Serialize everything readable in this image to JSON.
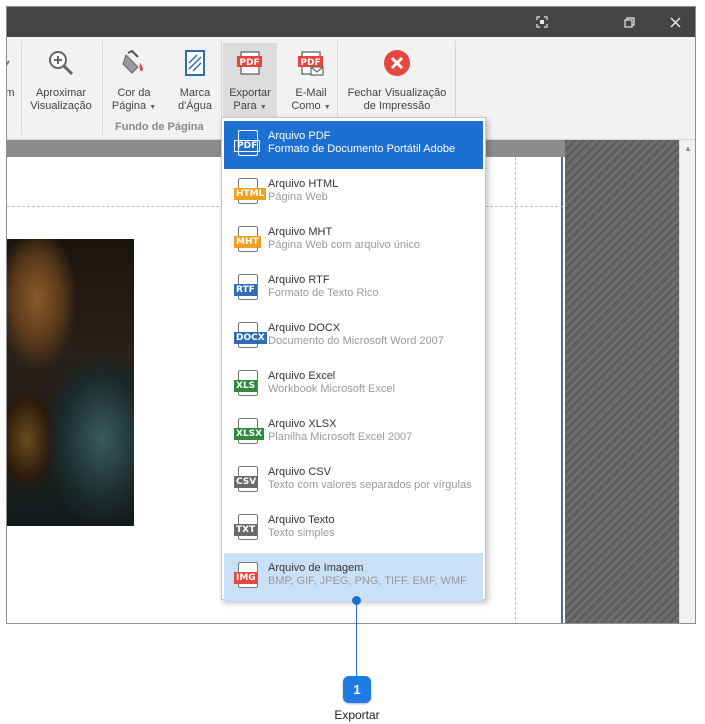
{
  "titlebar": {
    "buttons": [
      "fullscreen",
      "restore",
      "close"
    ]
  },
  "ribbon": {
    "partial_label": "m",
    "zoom": {
      "line1": "Aproximar",
      "line2": "Visualização"
    },
    "page_color": {
      "line1": "Cor da",
      "line2": "Página"
    },
    "watermark": {
      "line1": "Marca",
      "line2": "d'Água"
    },
    "export": {
      "line1": "Exportar",
      "line2": "Para"
    },
    "email": {
      "line1": "E-Mail",
      "line2": "Como"
    },
    "close_preview": {
      "line1": "Fechar Visualização",
      "line2": "de Impressão"
    },
    "group_label": "Fundo de Página",
    "pdf_icon_text": "PDF"
  },
  "menu": {
    "items": [
      {
        "badge": "PDF",
        "badge_color": "#e8453c",
        "title": "Arquivo PDF",
        "subtitle": "Formato de Documento Portátil Adobe",
        "state": "selected"
      },
      {
        "badge": "HTML",
        "badge_color": "#f0a01e",
        "title": "Arquivo HTML",
        "subtitle": "Página Web",
        "state": "normal"
      },
      {
        "badge": "MHT",
        "badge_color": "#f0a01e",
        "title": "Arquivo MHT",
        "subtitle": "Página Web com arquivo único",
        "state": "normal"
      },
      {
        "badge": "RTF",
        "badge_color": "#2f6db5",
        "title": "Arquivo RTF",
        "subtitle": "Formato de Texto Rico",
        "state": "normal"
      },
      {
        "badge": "DOCX",
        "badge_color": "#2f6db5",
        "title": "Arquivo DOCX",
        "subtitle": "Documento do Microsoft Word 2007",
        "state": "normal"
      },
      {
        "badge": "XLS",
        "badge_color": "#2e8b3e",
        "title": "Arquivo Excel",
        "subtitle": "Workbook Microsoft Excel",
        "state": "normal"
      },
      {
        "badge": "XLSX",
        "badge_color": "#2e8b3e",
        "title": "Arquivo XLSX",
        "subtitle": "Planilha Microsoft Excel 2007",
        "state": "normal"
      },
      {
        "badge": "CSV",
        "badge_color": "#6a6a6a",
        "title": "Arquivo CSV",
        "subtitle": "Texto com valores separados por vírgulas",
        "state": "normal"
      },
      {
        "badge": "TXT",
        "badge_color": "#6a6a6a",
        "title": "Arquivo Texto",
        "subtitle": "Texto simples",
        "state": "normal"
      },
      {
        "badge": "IMG",
        "badge_color": "#e8453c",
        "title": "Arquivo de Imagem",
        "subtitle": "BMP, GIF, JPEG, PNG, TIFF, EMF, WMF",
        "state": "hover"
      }
    ]
  },
  "callout": {
    "number": "1",
    "label": "Exportar"
  },
  "colors": {
    "accent": "#1e6fd2",
    "titlebar": "#444444",
    "close_red": "#e8453c"
  }
}
